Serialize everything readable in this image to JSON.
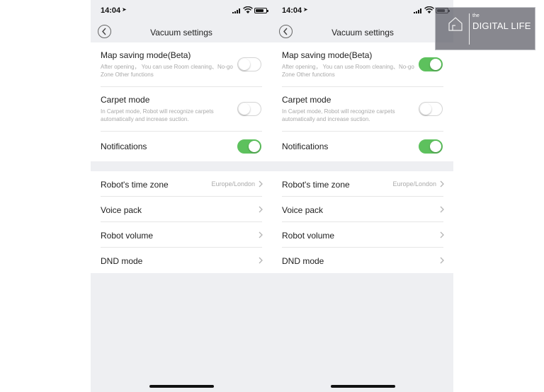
{
  "watermark": {
    "prefix": "the",
    "name": "DIGITAL LIFE"
  },
  "phones": [
    {
      "status": {
        "time": "14:04"
      },
      "nav": {
        "title": "Vacuum settings"
      },
      "settings": {
        "map_saving": {
          "title": "Map saving mode(Beta)",
          "desc": "After opening， You can use Room cleaning、No-go Zone Other functions",
          "enabled": false
        },
        "carpet": {
          "title": "Carpet mode",
          "desc": "In Carpet mode, Robot will recognize carpets automatically and increase suction.",
          "enabled": false
        },
        "notifications": {
          "title": "Notifications",
          "enabled": true
        }
      },
      "menu": {
        "time_zone": {
          "title": "Robot's time zone",
          "value": "Europe/London"
        },
        "voice_pack": {
          "title": "Voice pack"
        },
        "volume": {
          "title": "Robot volume"
        },
        "dnd": {
          "title": "DND mode"
        }
      }
    },
    {
      "status": {
        "time": "14:04"
      },
      "nav": {
        "title": "Vacuum settings"
      },
      "settings": {
        "map_saving": {
          "title": "Map saving mode(Beta)",
          "desc": "After opening， You can use Room cleaning、No-go Zone Other functions",
          "enabled": true
        },
        "carpet": {
          "title": "Carpet mode",
          "desc": "In Carpet mode, Robot will recognize carpets automatically and increase suction.",
          "enabled": false
        },
        "notifications": {
          "title": "Notifications",
          "enabled": true
        }
      },
      "menu": {
        "time_zone": {
          "title": "Robot's time zone",
          "value": "Europe/London"
        },
        "voice_pack": {
          "title": "Voice pack"
        },
        "volume": {
          "title": "Robot volume"
        },
        "dnd": {
          "title": "DND mode"
        }
      }
    }
  ],
  "colors": {
    "toggle_on": "#5dc15d",
    "page_bg": "#eeeff2",
    "muted_text": "#a9a9a9"
  },
  "icons": [
    "location-arrow-icon",
    "signal-icon",
    "wifi-icon",
    "battery-icon",
    "back-chevron-icon",
    "chevron-right-icon",
    "house-logo-icon"
  ]
}
